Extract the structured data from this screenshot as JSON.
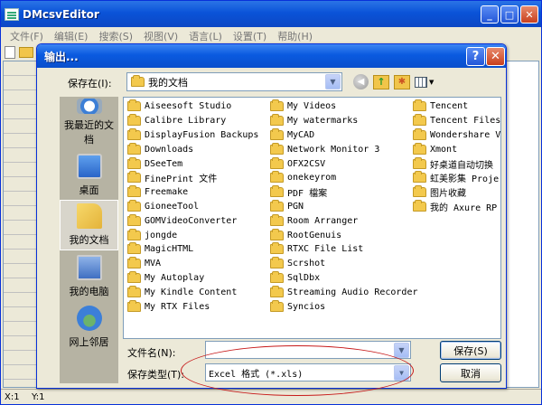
{
  "app": {
    "title": "DMcsvEditor",
    "min_glyph": "_",
    "max_glyph": "□",
    "close_glyph": "✕",
    "menu": [
      "文件(F)",
      "编辑(E)",
      "搜索(S)",
      "视图(V)",
      "语言(L)",
      "设置(T)",
      "帮助(H)"
    ],
    "status": {
      "x": "X:1",
      "y": "Y:1"
    }
  },
  "dialog": {
    "title": "输出...",
    "help_glyph": "?",
    "close_glyph": "✕",
    "save_in_label": "保存在(I):",
    "save_in_value": "我的文档",
    "places": {
      "recent": "我最近的文档",
      "desktop": "桌面",
      "documents": "我的文档",
      "computer": "我的电脑",
      "network": "网上邻居"
    },
    "files": {
      "col1": [
        "Aiseesoft Studio",
        "Calibre Library",
        "DisplayFusion Backups",
        "Downloads",
        "DSeeTem",
        "FinePrint 文件",
        "Freemake",
        "GioneeTool",
        "GOMVideoConverter",
        "jongde",
        "MagicHTML",
        "MVA",
        "My Autoplay",
        "My Kindle Content",
        "My RTX Files"
      ],
      "col2": [
        "My Videos",
        "My watermarks",
        "MyCAD",
        "Network Monitor 3",
        "OFX2CSV",
        "onekeyrom",
        "PDF 檔案",
        "PGN",
        "Room Arranger",
        "RootGenuis",
        "RTXC File List",
        "Scrshot",
        "SqlDbx",
        "Streaming Audio Recorder",
        "Syncios"
      ],
      "col3": [
        "Tencent",
        "Tencent Files",
        "Wondershare Vi",
        "Xmont",
        "好桌道自动切换",
        "虹美影集 Proje",
        "图片收藏",
        "我的 Axure RP"
      ]
    },
    "filename_label": "文件名(N):",
    "filename_value": "",
    "filetype_label": "保存类型(T):",
    "filetype_value": "Excel 格式 (*.xls)",
    "save_button": "保存(S)",
    "cancel_button": "取消"
  },
  "colors": {
    "titlebar": "#0a53d8",
    "dialog_bg": "#ece9d8",
    "folder": "#f3c94d",
    "highlight": "#c71a1a"
  }
}
